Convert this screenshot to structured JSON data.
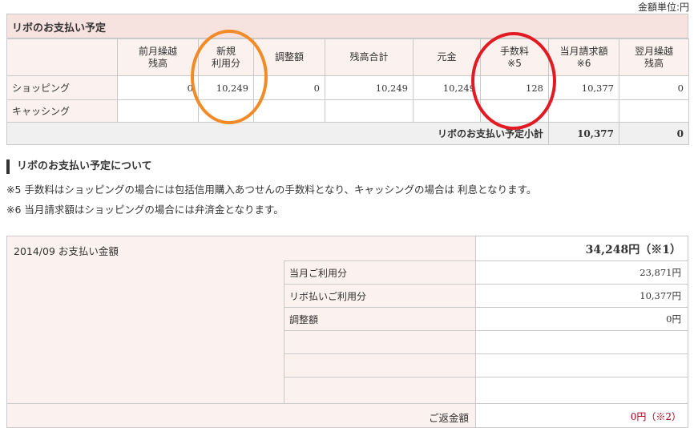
{
  "unit_label": "金額単位:円",
  "revo": {
    "header": "リボのお支払い予定",
    "columns": [
      "前月繰越\n残高",
      "新規\n利用分",
      "調整額",
      "残高合計",
      "元金",
      "手数料\n※5",
      "当月請求額\n※6",
      "翌月繰越\n残高"
    ],
    "rows": [
      {
        "label": "ショッピング",
        "values": [
          "0",
          "10,249",
          "0",
          "10,249",
          "10,249",
          "128",
          "10,377",
          "0"
        ]
      },
      {
        "label": "キャッシング",
        "values": [
          "",
          "",
          "",
          "",
          "",
          "",
          "",
          ""
        ]
      }
    ],
    "subtotal_label": "リボのお支払い予定小計",
    "subtotal_values": [
      "10,377",
      "0"
    ]
  },
  "notes": {
    "title": "リボのお支払い予定について",
    "note5": "※5 手数料はショッピングの場合には包括信用購入あつせんの手数料となり、キャッシングの場合は 利息となります。",
    "note6": "※6 当月請求額はショッピングの場合には弁済金となります。"
  },
  "payment": {
    "title": "2014/09 お支払い金額",
    "total": "34,248円（※1）",
    "rows": [
      {
        "label": "当月ご利用分",
        "value": "23,871円"
      },
      {
        "label": "リボ払いご利用分",
        "value": "10,377円"
      },
      {
        "label": "調整額",
        "value": "0円"
      },
      {
        "label": "",
        "value": ""
      },
      {
        "label": "",
        "value": ""
      },
      {
        "label": "",
        "value": ""
      }
    ],
    "refund_label": "ご返金額",
    "refund_value": "0円（※2）"
  },
  "colors": {
    "header_bg": "#f6e2de",
    "cell_bg": "#fbf1ee",
    "orange_circle": "#f28a27",
    "red_circle": "#e21a22",
    "refund_text": "#a3001b"
  }
}
